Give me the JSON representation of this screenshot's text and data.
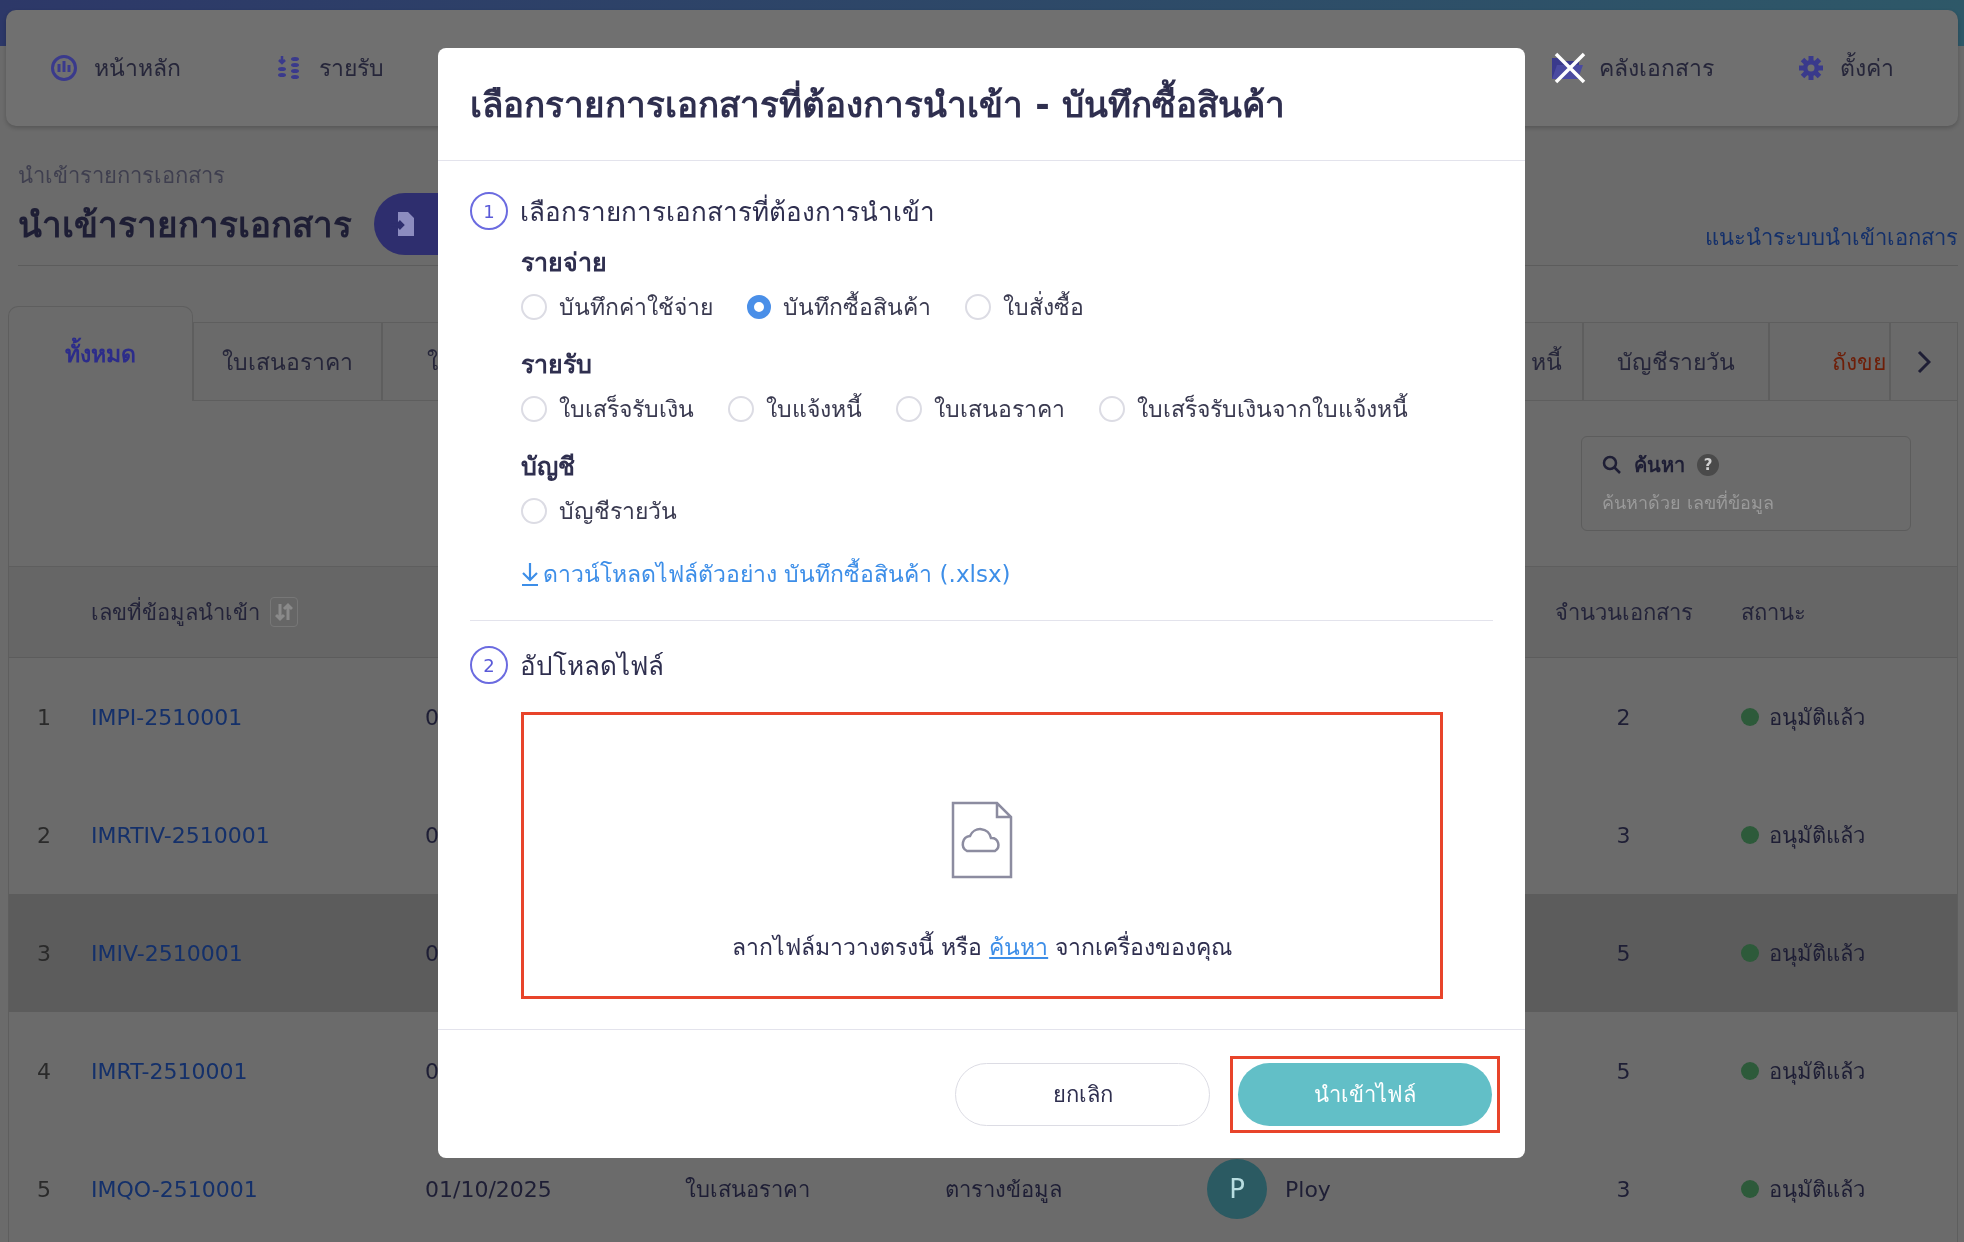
{
  "nav": {
    "left": [
      {
        "label": "หน้าหลัก"
      },
      {
        "label": "รายรับ"
      }
    ],
    "right": [
      {
        "label": "คลังเอกสาร"
      },
      {
        "label": "ตั้งค่า"
      }
    ]
  },
  "page": {
    "breadcrumb": "นำเข้ารายการเอกสาร",
    "title": "นำเข้ารายการเอกสาร",
    "guide_link": "แนะนำระบบนำเข้าเอกสาร"
  },
  "tabs_left": [
    {
      "label": "ทั้งหมด",
      "selected": true,
      "kind": "normal"
    },
    {
      "label": "ใบเสนอราคา",
      "selected": false,
      "kind": "normal"
    },
    {
      "label": "ใ",
      "selected": false,
      "kind": "normal"
    }
  ],
  "tabs_right": [
    {
      "label": "หนี้",
      "selected": false,
      "kind": "normal"
    },
    {
      "label": "บัญชีรายวัน",
      "selected": false,
      "kind": "normal"
    },
    {
      "label": "ถังขย",
      "selected": false,
      "kind": "danger"
    }
  ],
  "search": {
    "label": "ค้นหา",
    "help": "?",
    "placeholder": "ค้นหาด้วย เลขที่ข้อมูล"
  },
  "table": {
    "columns": [
      {
        "label": "เลขที่ข้อมูลนำเข้า",
        "sortable": true
      },
      {
        "label": "จำนวนเอกสาร",
        "sortable": false
      },
      {
        "label": "สถานะ",
        "sortable": false
      }
    ],
    "rows": [
      {
        "number": "1",
        "id": "IMPI-2510001",
        "date": "0",
        "count": "2",
        "status": "อนุมัติแล้ว",
        "hovered": false
      },
      {
        "number": "2",
        "id": "IMRTIV-2510001",
        "date": "0",
        "count": "3",
        "status": "อนุมัติแล้ว",
        "hovered": false
      },
      {
        "number": "3",
        "id": "IMIV-2510001",
        "date": "0",
        "count": "5",
        "status": "อนุมัติแล้ว",
        "hovered": true
      },
      {
        "number": "4",
        "id": "IMRT-2510001",
        "date": "0",
        "count": "5",
        "status": "อนุมัติแล้ว",
        "hovered": false
      },
      {
        "number": "5",
        "id": "IMQO-2510001",
        "date": "01/10/2025",
        "type": "ใบเสนอราคา",
        "source": "ตารางข้อมูล",
        "user": {
          "initial": "P",
          "name": "Ploy"
        },
        "count": "3",
        "status": "อนุมัติแล้ว",
        "hovered": false
      }
    ]
  },
  "dialog": {
    "title": "เลือกรายการเอกสารที่ต้องการนำเข้า - บันทึกซื้อสินค้า",
    "steps": [
      {
        "number": "1",
        "title": "เลือกรายการเอกสารที่ต้องการนำเข้า"
      },
      {
        "number": "2",
        "title": "อัปโหลดไฟล์"
      }
    ],
    "groups": [
      {
        "label": "รายจ่าย",
        "options": [
          {
            "label": "บันทึกค่าใช้จ่าย",
            "selected": false
          },
          {
            "label": "บันทึกซื้อสินค้า",
            "selected": true
          },
          {
            "label": "ใบสั่งซื้อ",
            "selected": false
          }
        ]
      },
      {
        "label": "รายรับ",
        "options": [
          {
            "label": "ใบเสร็จรับเงิน",
            "selected": false
          },
          {
            "label": "ใบแจ้งหนี้",
            "selected": false
          },
          {
            "label": "ใบเสนอราคา",
            "selected": false
          },
          {
            "label": "ใบเสร็จรับเงินจากใบแจ้งหนี้",
            "selected": false
          }
        ]
      },
      {
        "label": "บัญชี",
        "options": [
          {
            "label": "บัญชีรายวัน",
            "selected": false
          }
        ]
      }
    ],
    "download_link": "ดาวน์โหลดไฟล์ตัวอย่าง บันทึกซื้อสินค้า (.xlsx)",
    "dropzone": {
      "before": "ลากไฟล์มาวางตรงนี้ หรือ",
      "link": "ค้นหา",
      "after": "จากเครื่องของคุณ"
    },
    "buttons": {
      "cancel": "ยกเลิก",
      "import": "นำเข้าไฟล์"
    }
  }
}
